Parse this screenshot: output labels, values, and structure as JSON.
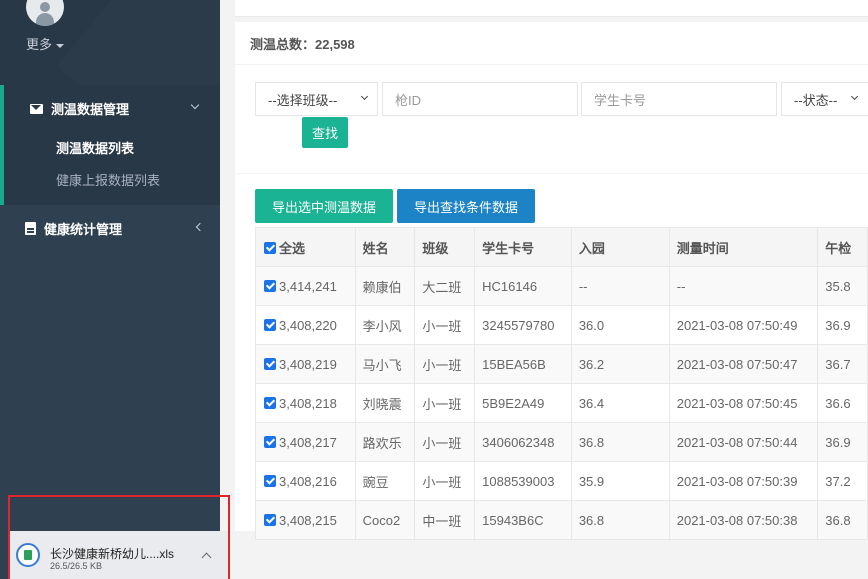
{
  "sidebar": {
    "more_label": "更多",
    "menu": [
      {
        "label": "测温数据管理",
        "icon": "envelope-icon",
        "expanded": true,
        "children": [
          {
            "label": "测温数据列表",
            "active": true
          },
          {
            "label": "健康上报数据列表",
            "active": false
          }
        ]
      },
      {
        "label": "健康统计管理",
        "icon": "document-icon",
        "expanded": false
      }
    ]
  },
  "download": {
    "file_name": "长沙健康新桥幼儿....xls",
    "size": "26.5/26.5 KB"
  },
  "summary": {
    "label": "测温总数：22,598"
  },
  "filters": {
    "class_select": "--选择班级--",
    "gun_id_placeholder": "枪ID",
    "card_placeholder": "学生卡号",
    "status_select": "--状态--",
    "search_label": "查找"
  },
  "actions": {
    "export_selected": "导出选中测温数据",
    "export_query": "导出查找条件数据"
  },
  "table": {
    "headers": [
      "全选",
      "姓名",
      "班级",
      "学生卡号",
      "入园",
      "测量时间",
      "午检"
    ],
    "rows": [
      [
        "3,414,241",
        "赖康伯",
        "大二班",
        "HC16146",
        "--",
        "--",
        "35.8"
      ],
      [
        "3,408,220",
        "李小风",
        "小一班",
        "3245579780",
        "36.0",
        "2021-03-08 07:50:49",
        "36.9"
      ],
      [
        "3,408,219",
        "马小飞",
        "小一班",
        "15BEA56B",
        "36.2",
        "2021-03-08 07:50:47",
        "36.7"
      ],
      [
        "3,408,218",
        "刘晓震",
        "小一班",
        "5B9E2A49",
        "36.4",
        "2021-03-08 07:50:45",
        "36.6"
      ],
      [
        "3,408,217",
        "路欢乐",
        "小一班",
        "3406062348",
        "36.8",
        "2021-03-08 07:50:44",
        "36.9"
      ],
      [
        "3,408,216",
        "豌豆",
        "小一班",
        "1088539003",
        "35.9",
        "2021-03-08 07:50:39",
        "37.2"
      ],
      [
        "3,408,215",
        "Coco2",
        "中一班",
        "15943B6C",
        "36.8",
        "2021-03-08 07:50:38",
        "36.8"
      ]
    ]
  }
}
